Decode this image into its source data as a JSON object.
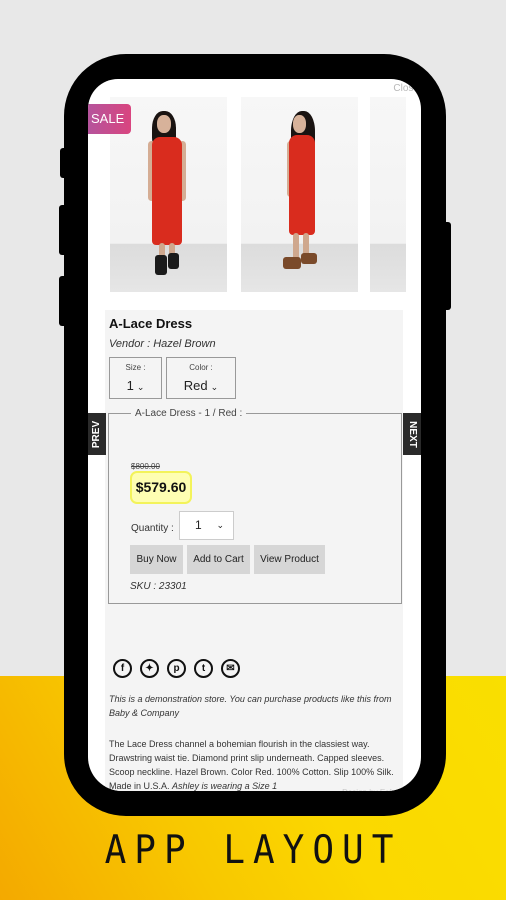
{
  "screen": {
    "close_label": "Close",
    "sale_badge": "SALE",
    "nav": {
      "prev_label": "PREV",
      "next_label": "NEXT"
    },
    "gallery": {
      "images": [
        {
          "alt": "Model in red lace dress, front view, black boots"
        },
        {
          "alt": "Model in red lace dress, side view, brown heels"
        },
        {
          "alt": "Model in red lace dress, partial view"
        }
      ]
    },
    "product": {
      "title": "A-Lace Dress",
      "vendor": "Vendor : Hazel Brown",
      "options": [
        {
          "label": "Size :",
          "value": "1"
        },
        {
          "label": "Color :",
          "value": "Red"
        }
      ],
      "variant_legend": "A-Lace Dress - 1 / Red :",
      "compare_price": "$800.00",
      "price": "$579.60",
      "quantity_label": "Quantity :",
      "quantity_value": "1",
      "buttons": {
        "buy_now": "Buy Now",
        "add_to_cart": "Add to Cart",
        "view_product": "View Product"
      },
      "sku": "SKU : 23301",
      "share_icons": [
        "facebook-icon",
        "twitter-icon",
        "pinterest-icon",
        "tumblr-icon",
        "email-icon"
      ],
      "demo_note": "This is a demonstration store. You can purchase products like this from Baby & Company",
      "description": "The Lace Dress channel a bohemian flourish in the classiest way. Drawstring waist tie. Diamond print slip underneath. Capped sleeves. Scoop neckline. Hazel Brown. Color Red. 100% Cotton. Slip 100% Silk. Made in U.S.A.",
      "description_note": "Ashley is wearing a Size 1",
      "footer_credit": "Design by Esfera"
    }
  },
  "caption": "APP LAYOUT",
  "colors": {
    "sale_badge": "#d9457f",
    "price_highlight": "#fefeb2",
    "background_top": "#e8e8e8",
    "background_bottom": "#f8c800"
  }
}
